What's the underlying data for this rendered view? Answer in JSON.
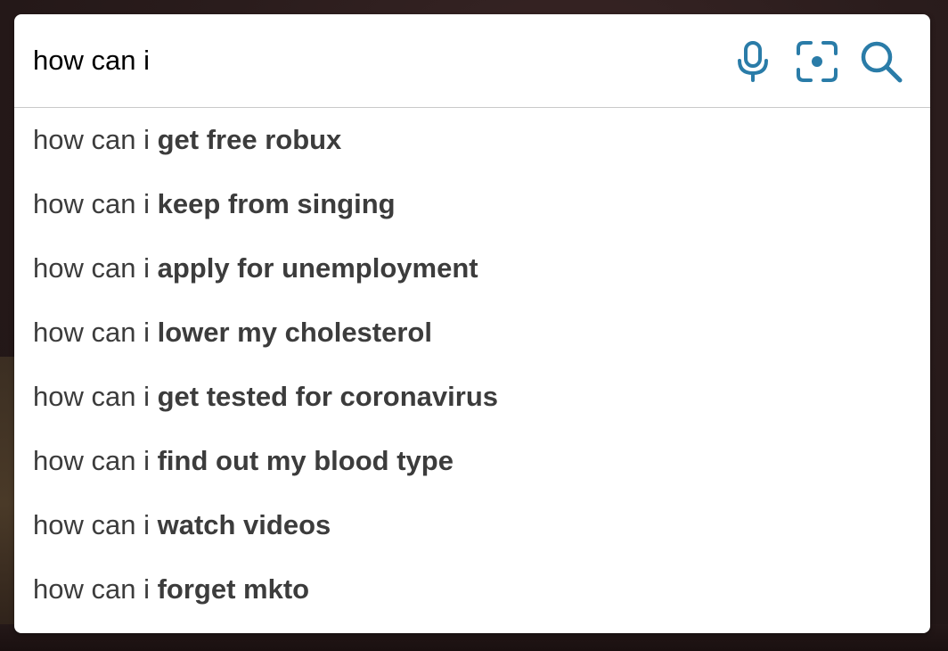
{
  "colors": {
    "icon_accent": "#2a7ca8",
    "text": "#3c3c3c",
    "panel_bg": "#ffffff"
  },
  "search": {
    "value": "how can i",
    "placeholder": ""
  },
  "icons": [
    {
      "name": "microphone-icon"
    },
    {
      "name": "camera-lens-icon"
    },
    {
      "name": "search-icon"
    }
  ],
  "suggestions": [
    {
      "prefix": "how can i ",
      "completion": "get free robux"
    },
    {
      "prefix": "how can i ",
      "completion": "keep from singing"
    },
    {
      "prefix": "how can i ",
      "completion": "apply for unemployment"
    },
    {
      "prefix": "how can i ",
      "completion": "lower my cholesterol"
    },
    {
      "prefix": "how can i ",
      "completion": "get tested for coronavirus"
    },
    {
      "prefix": "how can i ",
      "completion": "find out my blood type"
    },
    {
      "prefix": "how can i ",
      "completion": "watch videos"
    },
    {
      "prefix": "how can i ",
      "completion": "forget mkto"
    }
  ]
}
